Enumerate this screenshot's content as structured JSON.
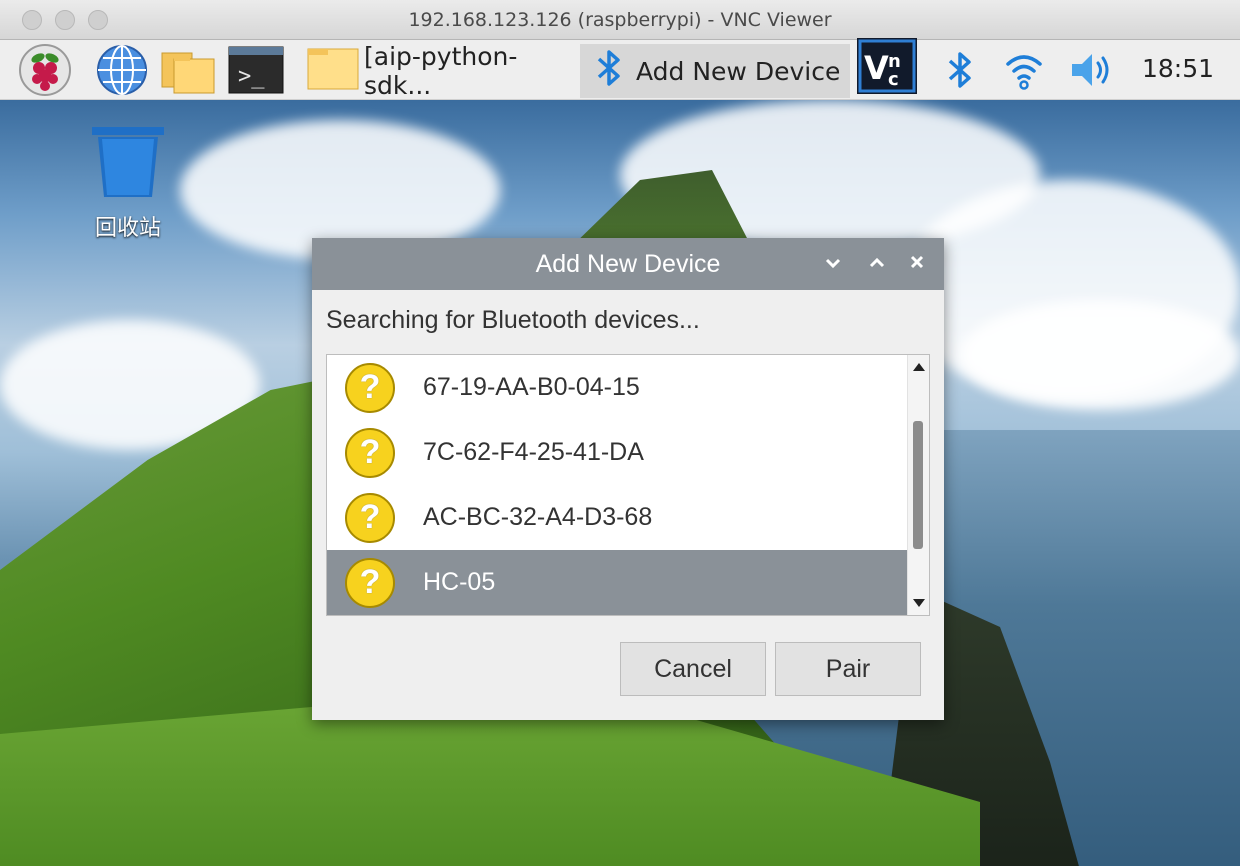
{
  "window": {
    "title": "192.168.123.126 (raspberrypi) - VNC Viewer"
  },
  "taskbar": {
    "items": [
      {
        "name": "raspberry-menu-icon"
      },
      {
        "name": "web-browser-icon"
      },
      {
        "name": "file-manager-icon"
      },
      {
        "name": "terminal-icon"
      }
    ],
    "tasks": [
      {
        "label": "[aip-python-sdk...",
        "icon": "folder-icon"
      },
      {
        "label": "Add New Device",
        "icon": "bluetooth-icon",
        "active": true
      }
    ],
    "tray": {
      "vnc": "vnc-icon",
      "bluetooth": "bluetooth-icon",
      "wifi": "wifi-icon",
      "volume": "volume-icon",
      "clock": "18:51"
    }
  },
  "desktop": {
    "trash_label": "回收站"
  },
  "dialog": {
    "title": "Add New Device",
    "status": "Searching for Bluetooth devices...",
    "devices": [
      {
        "name": "67-19-AA-B0-04-15",
        "icon": "unknown-device-icon"
      },
      {
        "name": "7C-62-F4-25-41-DA",
        "icon": "unknown-device-icon"
      },
      {
        "name": "AC-BC-32-A4-D3-68",
        "icon": "unknown-device-icon"
      },
      {
        "name": "HC-05",
        "icon": "unknown-device-icon",
        "selected": true
      }
    ],
    "cancel_label": "Cancel",
    "pair_label": "Pair"
  },
  "colors": {
    "dialog_titlebar": "#8a9198",
    "selected_row": "#8a9198",
    "device_icon": "#f7d21e"
  }
}
